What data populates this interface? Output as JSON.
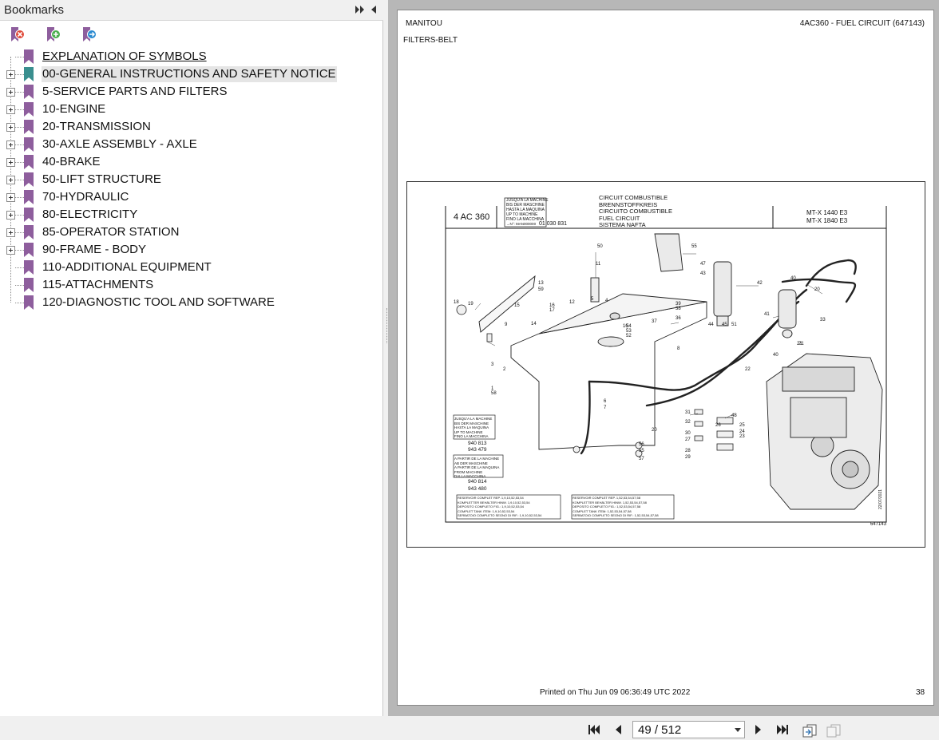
{
  "bookmarks_panel": {
    "title": "Bookmarks",
    "items": [
      {
        "label": "EXPLANATION OF SYMBOLS",
        "expandable": false
      },
      {
        "label": "00-GENERAL INSTRUCTIONS AND SAFETY NOTICE",
        "expandable": true,
        "selected": true
      },
      {
        "label": "5-SERVICE PARTS AND FILTERS",
        "expandable": true
      },
      {
        "label": "10-ENGINE",
        "expandable": true
      },
      {
        "label": "20-TRANSMISSION",
        "expandable": true
      },
      {
        "label": "30-AXLE ASSEMBLY - AXLE",
        "expandable": true
      },
      {
        "label": "40-BRAKE",
        "expandable": true
      },
      {
        "label": "50-LIFT STRUCTURE",
        "expandable": true
      },
      {
        "label": "70-HYDRAULIC",
        "expandable": true
      },
      {
        "label": "80-ELECTRICITY",
        "expandable": true
      },
      {
        "label": "85-OPERATOR STATION",
        "expandable": true
      },
      {
        "label": "90-FRAME - BODY",
        "expandable": true
      },
      {
        "label": "110-ADDITIONAL EQUIPMENT",
        "expandable": false
      },
      {
        "label": "115-ATTACHMENTS",
        "expandable": false
      },
      {
        "label": "120-DIAGNOSTIC TOOL AND SOFTWARE",
        "expandable": false
      }
    ]
  },
  "page": {
    "header_left": "MANITOU",
    "header_right": "4AC360 - FUEL CIRCUIT (647143)",
    "subheader": "FILTERS-BELT",
    "footer_printed": "Printed on  Thu Jun 09 06:36:49 UTC 2022",
    "page_number": "38"
  },
  "figure": {
    "code": "4 AC 360",
    "model_line1": "MT-X 1440 E3",
    "model_line2": "MT-X 1840 E3",
    "titles": [
      "CIRCUIT COMBUSTIBLE",
      "BRENNSTOFFKREIS",
      "CIRCUITO COMBUSTIBLE",
      "FUEL CIRCUIT",
      "SISTEMA NAFTA"
    ],
    "upto_box": [
      "JUSQU'A LA MACHINE",
      "BIS DER MASCHINE",
      "HASTA LA MAQUINA",
      "UP TO MACHINE",
      "FINO LA MACCHINA"
    ],
    "serial": "01 030 831",
    "serial_prefix": "→N°: MAN000000",
    "left_note_1": [
      "JUSQU'A LA MACHINE",
      "BIS DER MASCHINE",
      "HASTA LA MAQUINA",
      "UP TO MACHINE",
      "FINO LA MACCHINA"
    ],
    "left_serial_1a": "940 813",
    "left_serial_1b": "943 479",
    "left_note_2": [
      "A PARTIR DE LA MACHINE",
      "AB DER MASCHINE",
      "A PARTIR DE LA MAQUINA",
      "FROM MACHINE",
      "DALLA MACCHINA"
    ],
    "left_serial_2a": "940 814",
    "left_serial_2b": "943 480",
    "reservoir_left": [
      "RESERVOIR COMPLET REP. 1,9,10,52,53,54",
      "KOMPLETTER BEHÄLTER HINW. 1,9,10,52,53,54",
      "DEPOSITO COMPLETO FIG.: 1,9,10,52,53,54",
      "COMPLET TANK ITEM: 1,9,10,52,53,54",
      "SERBATOIO COMPLETO SEGNO DI RIF.: 1,9,10,52,53,54"
    ],
    "reservoir_right": [
      "RESERVOIR COMPLET REP. 1,52,53,54,57,58",
      "KOMPLETTER BEHÄLTER HINW. 1,52,53,54,57,58",
      "DEPOSITO COMPLETO FIG.: 1,52,53,54,57,58",
      "COMPLET TANK ITEM: 1,52,53,54,57,58",
      "SERBATOIO COMPLETO SEGNO DI RIF.: 1,52,53,54,57,58"
    ],
    "ref": "647143",
    "date": "22/07/2021",
    "callouts": [
      "50",
      "11",
      "55",
      "47",
      "43",
      "42",
      "40",
      "20",
      "41",
      "33",
      "13",
      "59",
      "12",
      "5",
      "4",
      "39",
      "38",
      "18",
      "19",
      "15",
      "16",
      "17",
      "14",
      "9",
      "37",
      "36",
      "51",
      "44",
      "45",
      "10",
      "54",
      "53",
      "52",
      "8",
      "21",
      "22",
      "40",
      "3",
      "2",
      "1",
      "58",
      "6",
      "7",
      "20",
      "31",
      "32",
      "30",
      "27",
      "28",
      "29",
      "48",
      "26",
      "25",
      "24",
      "23",
      "21",
      "56",
      "55",
      "57"
    ]
  },
  "navbar": {
    "page_value": "49 / 512"
  },
  "colors": {
    "bookmark_icon": "#8e5e9d",
    "bookmark_icon_selected": "#3a8f8f",
    "accent": "#2a6fb0"
  }
}
